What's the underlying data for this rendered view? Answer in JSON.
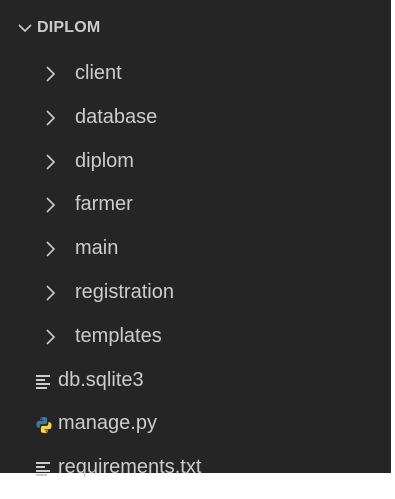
{
  "explorer": {
    "root": {
      "label": "DIPLOM",
      "icon": "chevron-down-icon",
      "expanded": true
    },
    "folders": [
      {
        "label": "client",
        "icon": "chevron-right-icon"
      },
      {
        "label": "database",
        "icon": "chevron-right-icon"
      },
      {
        "label": "diplom",
        "icon": "chevron-right-icon"
      },
      {
        "label": "farmer",
        "icon": "chevron-right-icon"
      },
      {
        "label": "main",
        "icon": "chevron-right-icon"
      },
      {
        "label": "registration",
        "icon": "chevron-right-icon"
      },
      {
        "label": "templates",
        "icon": "chevron-right-icon"
      }
    ],
    "files": [
      {
        "label": "db.sqlite3",
        "icon": "text-file-icon"
      },
      {
        "label": "manage.py",
        "icon": "python-file-icon"
      },
      {
        "label": "requirements.txt",
        "icon": "text-file-icon"
      }
    ],
    "colors": {
      "background": "#252526",
      "text": "#cccccc",
      "python_blue": "#3c78aa",
      "python_yellow": "#ffd43b"
    }
  }
}
